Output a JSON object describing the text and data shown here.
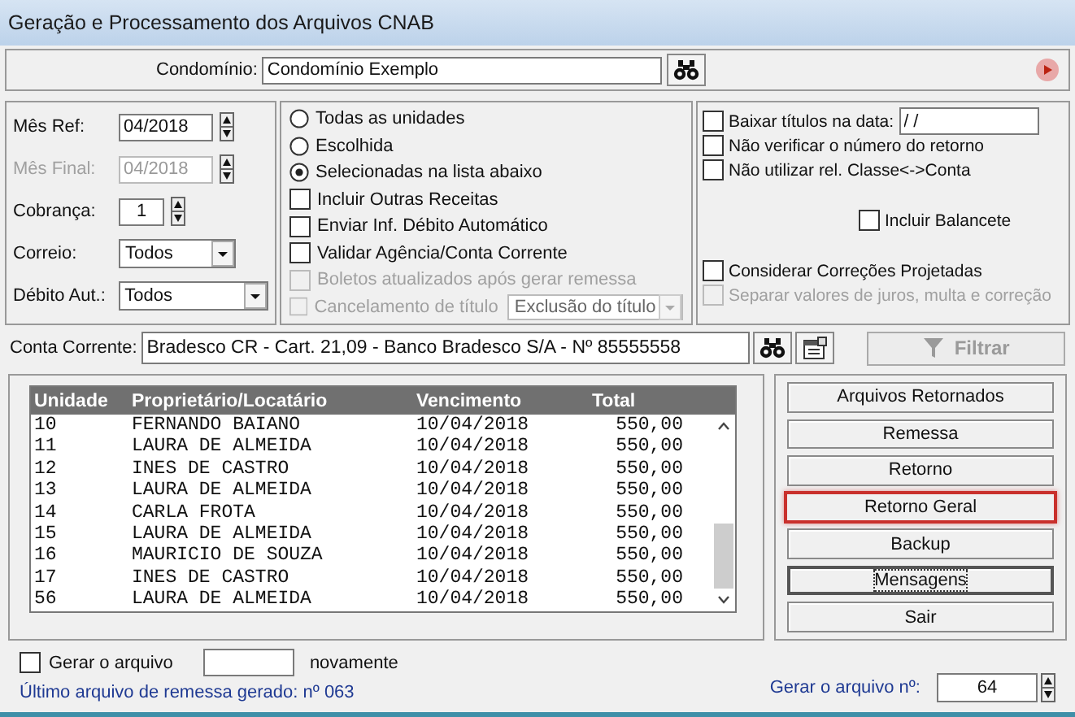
{
  "window": {
    "title": "Geração e Processamento dos Arquivos CNAB"
  },
  "condominio": {
    "label": "Condomínio:",
    "value": "Condomínio Exemplo"
  },
  "period_fields": [
    {
      "kind": "spin",
      "label": "Mês Ref:",
      "value": "04/2018",
      "disabled": false
    },
    {
      "kind": "spin",
      "label": "Mês Final:",
      "value": "04/2018",
      "disabled": true
    },
    {
      "kind": "spin-small",
      "label": "Cobrança:",
      "value": "1",
      "disabled": false
    },
    {
      "kind": "dropdown",
      "label": "Correio:",
      "value": "Todos"
    },
    {
      "kind": "dropdown-wide",
      "label": "Débito Aut.:",
      "value": "Todos"
    }
  ],
  "options": [
    {
      "kind": "radio",
      "label": "Todas as unidades",
      "selected": false,
      "disabled": false
    },
    {
      "kind": "radio",
      "label": "Escolhida",
      "selected": false,
      "disabled": false
    },
    {
      "kind": "radio",
      "label": "Selecionadas na lista abaixo",
      "selected": true,
      "disabled": false
    },
    {
      "kind": "checkbox",
      "label": "Incluir Outras Receitas",
      "checked": false,
      "disabled": false
    },
    {
      "kind": "checkbox",
      "label": "Enviar Inf. Débito Automático",
      "checked": false,
      "disabled": false
    },
    {
      "kind": "checkbox",
      "label": "Validar Agência/Conta Corrente",
      "checked": false,
      "disabled": false
    },
    {
      "kind": "checkbox",
      "label": "Boletos atualizados após gerar remessa",
      "checked": false,
      "disabled": true
    },
    {
      "kind": "checkbox-select",
      "label": "Cancelamento de título",
      "checked": false,
      "disabled": true,
      "select_value": "Exclusão do título"
    }
  ],
  "extra_options": [
    {
      "kind": "checkbox-date",
      "label": "Baixar títulos na data:",
      "checked": false,
      "disabled": false,
      "value": "/ /"
    },
    {
      "kind": "checkbox",
      "label": "Não verificar o número do retorno",
      "checked": false,
      "disabled": false
    },
    {
      "kind": "checkbox",
      "label": "Não utilizar rel. Classe<->Conta",
      "checked": false,
      "disabled": false
    },
    {
      "kind": "checkbox-centered",
      "label": "Incluir Balancete",
      "checked": false,
      "disabled": false
    },
    {
      "kind": "checkbox-spaced",
      "label": "Considerar Correções Projetadas",
      "checked": false,
      "disabled": false
    },
    {
      "kind": "checkbox",
      "label": "Separar valores de juros, multa e correção",
      "checked": false,
      "disabled": true
    }
  ],
  "conta_corrente": {
    "label": "Conta Corrente:",
    "value": "Bradesco CR - Cart. 21,09 - Banco Bradesco S/A - Nº 85555558"
  },
  "filter_button": {
    "label": "Filtrar",
    "disabled": true
  },
  "table": {
    "columns": [
      "Unidade",
      "Proprietário/Locatário",
      "Vencimento",
      "Total"
    ],
    "rows": [
      [
        "10",
        "FERNANDO BAIANO",
        "10/04/2018",
        "550,00"
      ],
      [
        "11",
        "LAURA DE ALMEIDA",
        "10/04/2018",
        "550,00"
      ],
      [
        "12",
        "INES DE CASTRO",
        "10/04/2018",
        "550,00"
      ],
      [
        "13",
        "LAURA DE ALMEIDA",
        "10/04/2018",
        "550,00"
      ],
      [
        "14",
        "CARLA FROTA",
        "10/04/2018",
        "550,00"
      ],
      [
        "15",
        "LAURA DE ALMEIDA",
        "10/04/2018",
        "550,00"
      ],
      [
        "16",
        "MAURICIO DE SOUZA",
        "10/04/2018",
        "550,00"
      ],
      [
        "17",
        "INES DE CASTRO",
        "10/04/2018",
        "550,00"
      ],
      [
        "56",
        "LAURA DE ALMEIDA",
        "10/04/2018",
        "550,00"
      ]
    ]
  },
  "actions": [
    {
      "label": "Arquivos Retornados",
      "highlighted": false,
      "focused": false
    },
    {
      "label": "Remessa",
      "highlighted": false,
      "focused": false
    },
    {
      "label": "Retorno",
      "highlighted": false,
      "focused": false
    },
    {
      "label": "Retorno Geral",
      "highlighted": true,
      "focused": false
    },
    {
      "label": "Backup",
      "highlighted": false,
      "focused": false
    },
    {
      "label": "Mensagens",
      "highlighted": false,
      "focused": true
    },
    {
      "label": "Sair",
      "highlighted": false,
      "focused": false
    }
  ],
  "regenerate": {
    "label": "Gerar o arquivo",
    "checked": false,
    "suffix": "novamente"
  },
  "last_file": "Último arquivo de remessa gerado: nº 063",
  "file_number": {
    "label": "Gerar o arquivo nº:",
    "value": "64"
  }
}
